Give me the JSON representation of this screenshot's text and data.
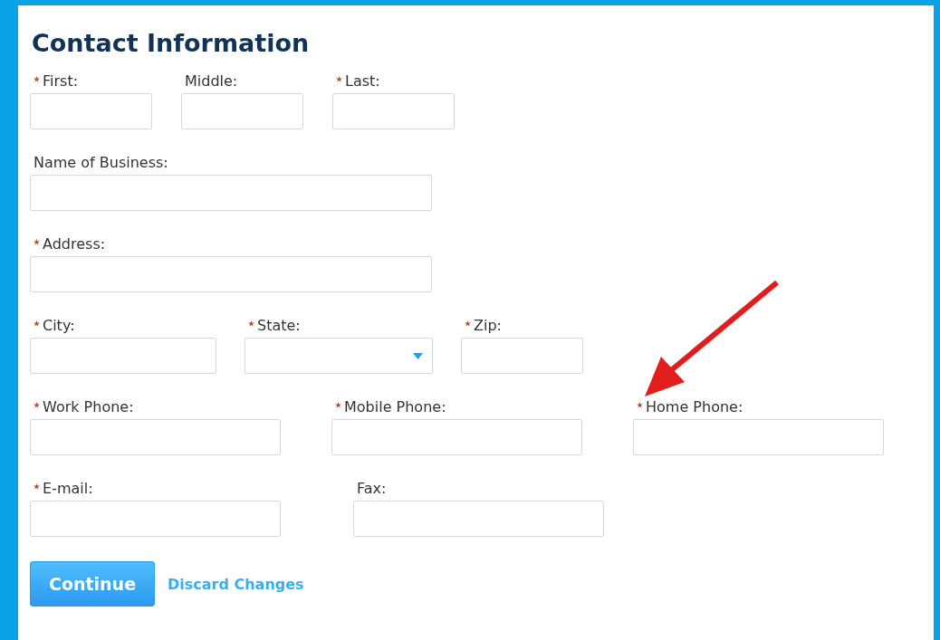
{
  "title": "Contact Information",
  "rows": [
    {
      "fields": [
        {
          "label": "First:",
          "required": true,
          "kind": "text"
        },
        {
          "label": "Middle:",
          "required": false,
          "kind": "text"
        },
        {
          "label": "Last:",
          "required": true,
          "kind": "text"
        }
      ]
    },
    {
      "fields": [
        {
          "label": "Name of Business:",
          "required": false,
          "kind": "text"
        }
      ]
    },
    {
      "fields": [
        {
          "label": "Address:",
          "required": true,
          "kind": "text"
        }
      ]
    },
    {
      "fields": [
        {
          "label": "City:",
          "required": true,
          "kind": "text"
        },
        {
          "label": "State:",
          "required": true,
          "kind": "select"
        },
        {
          "label": "Zip:",
          "required": true,
          "kind": "text"
        }
      ]
    },
    {
      "fields": [
        {
          "label": "Work Phone:",
          "required": true,
          "kind": "text"
        },
        {
          "label": "Mobile Phone:",
          "required": true,
          "kind": "text"
        },
        {
          "label": "Home Phone:",
          "required": true,
          "kind": "text"
        }
      ]
    },
    {
      "fields": [
        {
          "label": "E-mail:",
          "required": true,
          "kind": "text"
        },
        {
          "label": "Fax:",
          "required": false,
          "kind": "text"
        }
      ]
    }
  ],
  "buttons": {
    "primary": "Continue",
    "link": "Discard Changes"
  }
}
